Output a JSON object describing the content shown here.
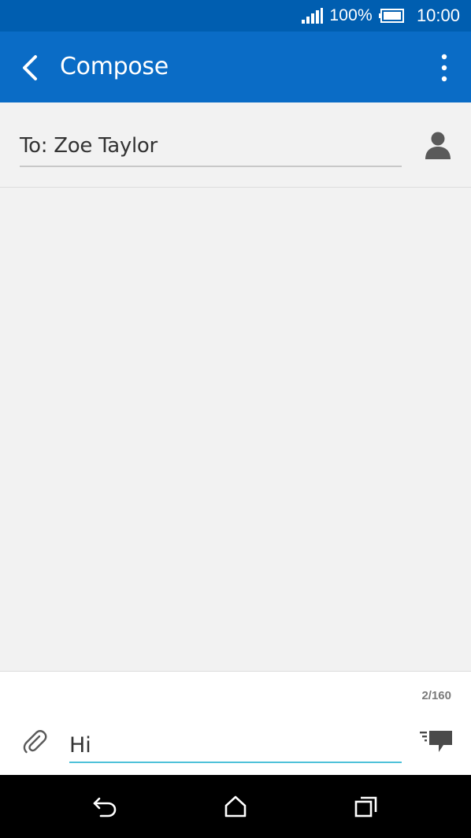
{
  "status_bar": {
    "battery_percent": "100%",
    "time": "10:00"
  },
  "app_bar": {
    "title": "Compose",
    "back_icon": "chevron-left-icon",
    "menu_icon": "more-vertical-icon"
  },
  "recipient": {
    "value": "To: Zoe Taylor",
    "contact_icon": "person-icon"
  },
  "compose": {
    "char_count": "2/160",
    "message_value": "Hi",
    "attach_icon": "paperclip-icon",
    "send_icon": "send-message-icon"
  },
  "nav_bar": {
    "back_icon": "back-arrow-icon",
    "home_icon": "home-icon",
    "recents_icon": "recent-apps-icon"
  },
  "colors": {
    "status_bar": "#005eb0",
    "app_bar": "#0a6cc6",
    "input_underline": "#4fc1d9",
    "background": "#f2f2f2"
  }
}
